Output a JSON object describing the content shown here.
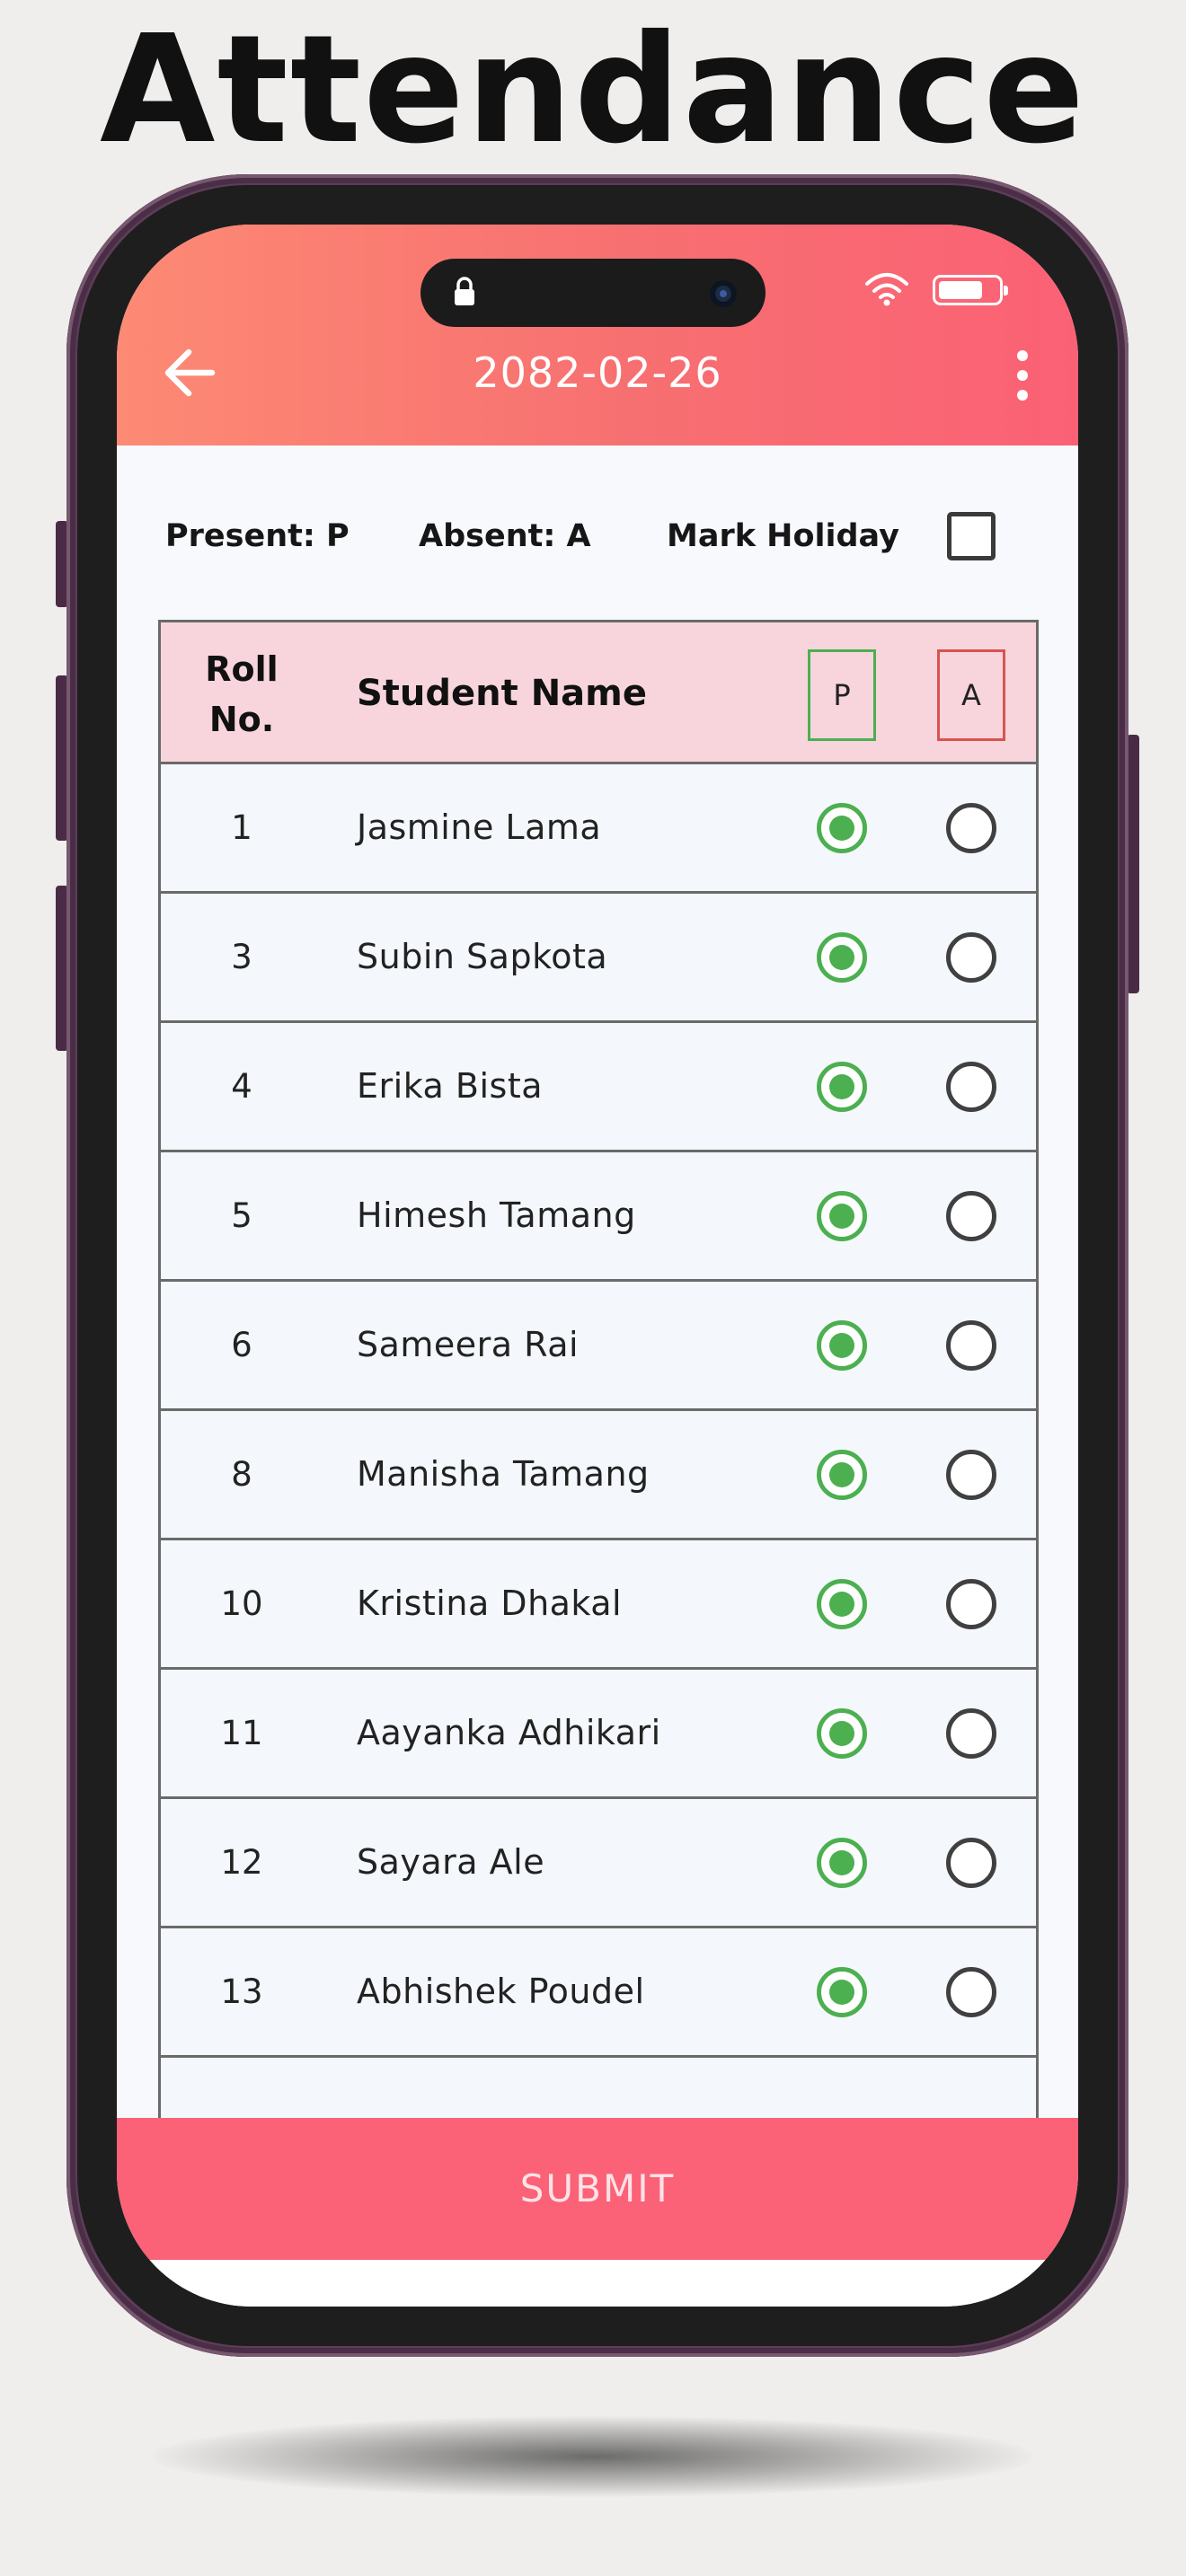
{
  "page_title": "Attendance",
  "app_bar": {
    "date": "2082-02-26",
    "back_icon": "arrow-left-icon",
    "menu_icon": "more-vertical-icon"
  },
  "status_bar": {
    "icons": [
      "lock-icon",
      "camera-icon",
      "wifi-icon",
      "battery-icon"
    ]
  },
  "legend": {
    "present": "Present: P",
    "absent": "Absent: A",
    "mark_holiday": "Mark Holiday",
    "mark_holiday_checked": false
  },
  "table": {
    "headers": {
      "roll_line1": "Roll",
      "roll_line2": "No.",
      "name": "Student Name",
      "present": "P",
      "absent": "A"
    },
    "rows": [
      {
        "roll": "1",
        "name": "Jasmine Lama",
        "status": "P"
      },
      {
        "roll": "3",
        "name": "Subin Sapkota",
        "status": "P"
      },
      {
        "roll": "4",
        "name": "Erika Bista",
        "status": "P"
      },
      {
        "roll": "5",
        "name": "Himesh Tamang",
        "status": "P"
      },
      {
        "roll": "6",
        "name": "Sameera Rai",
        "status": "P"
      },
      {
        "roll": "8",
        "name": "Manisha Tamang",
        "status": "P"
      },
      {
        "roll": "10",
        "name": "Kristina Dhakal",
        "status": "P"
      },
      {
        "roll": "11",
        "name": "Aayanka Adhikari",
        "status": "P"
      },
      {
        "roll": "12",
        "name": "Sayara Ale",
        "status": "P"
      },
      {
        "roll": "13",
        "name": "Abhishek Poudel",
        "status": "P"
      }
    ]
  },
  "submit_label": "SUBMIT",
  "colors": {
    "accent": "#fb6277",
    "header_gradient_start": "#fd8a74",
    "present_green": "#4caf50",
    "absent_red": "#d9534f",
    "table_header_bg": "#f8d5dc"
  }
}
